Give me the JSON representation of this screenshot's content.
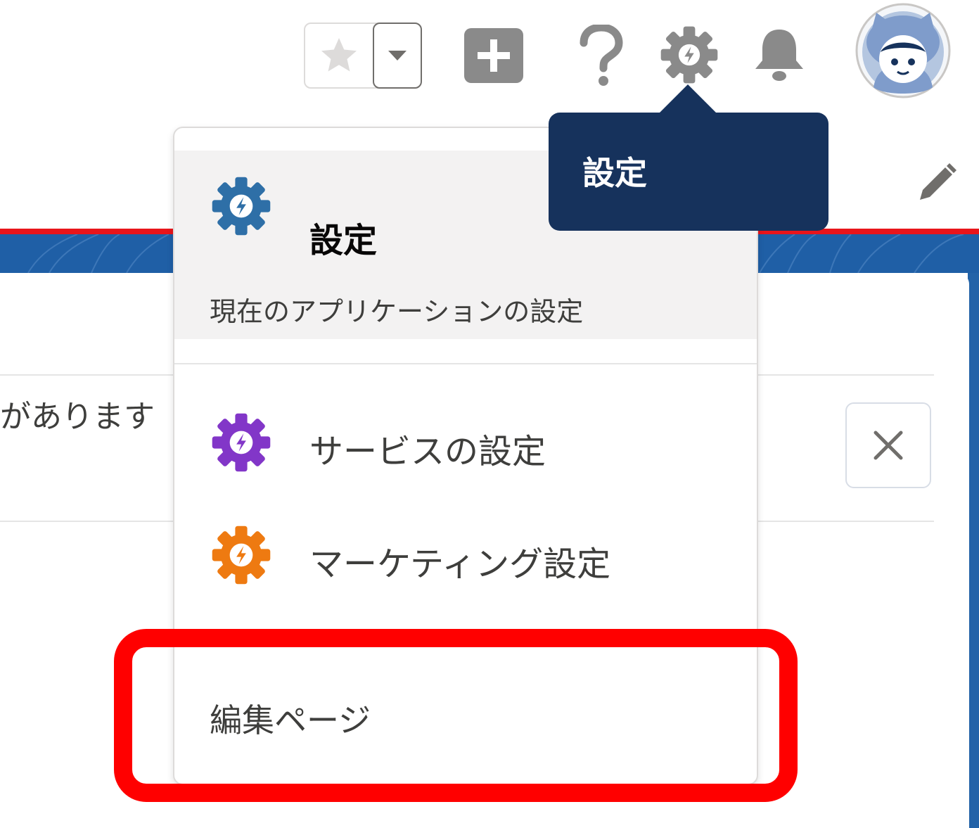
{
  "header": {
    "favorites_icon": "star-icon",
    "favorites_dropdown_icon": "caret-down-icon",
    "global_actions_icon": "plus-icon",
    "help_icon": "question-icon",
    "setup_icon": "gear-icon",
    "notifications_icon": "bell-icon",
    "avatar_icon": "astro-avatar"
  },
  "tooltip": {
    "text": "設定"
  },
  "setup_menu": {
    "header": {
      "title": "設定",
      "subtitle": "現在のアプリケーションの設定",
      "icon_color": "#2e6fa7"
    },
    "items": [
      {
        "label": "サービスの設定",
        "icon_color": "#8236c8"
      },
      {
        "label": "マーケティング設定",
        "icon_color": "#ee7a11"
      }
    ],
    "edit_page_label": "編集ページ"
  },
  "page": {
    "notice_text": "があります",
    "close_icon": "close-icon"
  },
  "colors": {
    "brand_band": "#1f5fa6",
    "tooltip_bg": "#16325c",
    "highlight": "#ff0000",
    "rule_red": "#e8151b"
  }
}
